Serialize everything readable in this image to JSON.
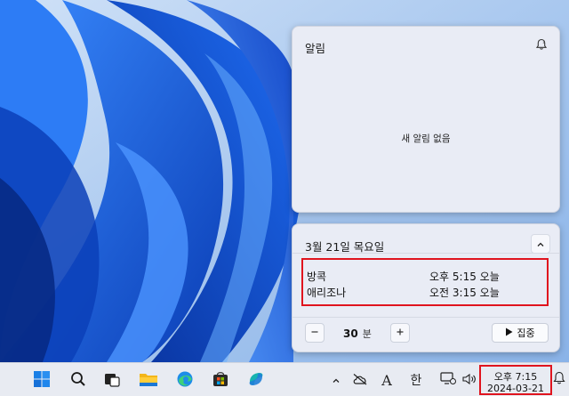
{
  "notifications": {
    "title": "알림",
    "empty_text": "새 알림 없음",
    "dnd_icon": "bell-snooze-icon"
  },
  "calendar": {
    "date_label": "3월 21일 목요일",
    "clocks": [
      {
        "city": "방콕",
        "time": "오후 5:15 오늘"
      },
      {
        "city": "애리조나",
        "time": "오전 3:15 오늘"
      }
    ],
    "focus": {
      "minutes": "30",
      "unit": "분",
      "start_label": "집중"
    }
  },
  "taskbar": {
    "apps": [
      "start-icon",
      "search-icon",
      "task-view-icon",
      "file-explorer-icon",
      "edge-icon",
      "store-icon",
      "copilot-icon"
    ],
    "tray": {
      "ime_letter": "A",
      "language": "한"
    },
    "clock": {
      "time": "오후 7:15",
      "date": "2024-03-21"
    }
  },
  "colors": {
    "highlight": "#e0141e",
    "wallpaper_blue": "#1e5fd8",
    "panel_bg": "#e9ecf5"
  }
}
